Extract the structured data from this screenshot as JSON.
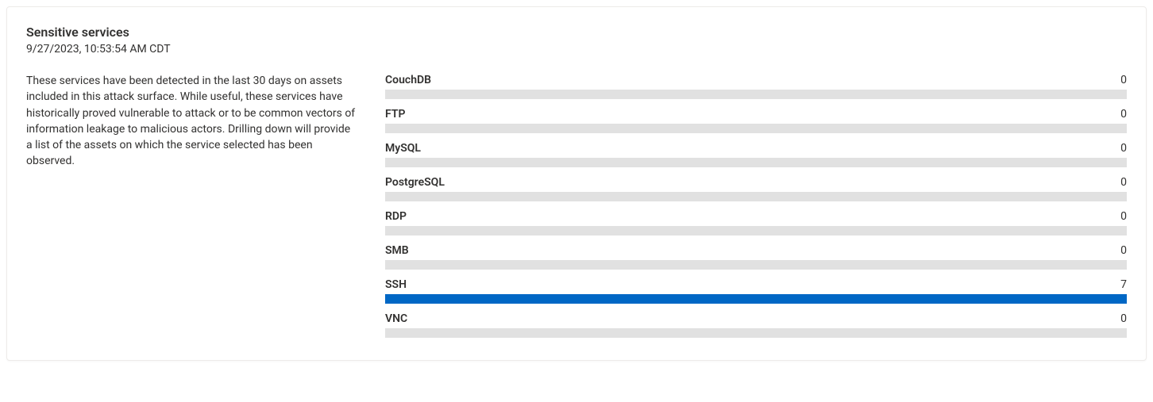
{
  "card": {
    "title": "Sensitive services",
    "timestamp": "9/27/2023, 10:53:54 AM CDT",
    "description": "These services have been detected in the last 30 days on assets included in this attack surface. While useful, these services have historically proved vulnerable to attack or to be common vectors of information leakage to malicious actors. Drilling down will provide a list of the assets on which the service selected has been observed."
  },
  "colors": {
    "bar_bg": "#e1e1e1",
    "bar_fill": "#0067c5"
  },
  "chart_data": {
    "type": "bar",
    "orientation": "horizontal",
    "categories": [
      "CouchDB",
      "FTP",
      "MySQL",
      "PostgreSQL",
      "RDP",
      "SMB",
      "SSH",
      "VNC"
    ],
    "values": [
      0,
      0,
      0,
      0,
      0,
      0,
      7,
      0
    ],
    "max_scale": 7,
    "title": "Sensitive services",
    "xlabel": "",
    "ylabel": ""
  }
}
